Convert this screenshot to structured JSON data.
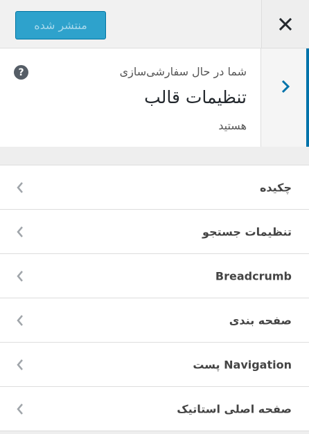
{
  "header": {
    "publish_label": "منتشر شده",
    "close_icon": "close-icon"
  },
  "info": {
    "line1": "شما در حال سفارشی‌سازی",
    "title": "تنظیمات قالب",
    "line3": "هستید",
    "help_glyph": "?"
  },
  "menu": {
    "items": [
      {
        "label": "چکیده"
      },
      {
        "label": "تنظیمات جستجو"
      },
      {
        "label": "Breadcrumb"
      },
      {
        "label": "صفحه بندی"
      },
      {
        "label": "Navigation پست"
      },
      {
        "label": "صفحه اصلی استاتیک"
      }
    ]
  },
  "colors": {
    "accent": "#0073aa",
    "publish_bg": "#2ea2cc"
  }
}
